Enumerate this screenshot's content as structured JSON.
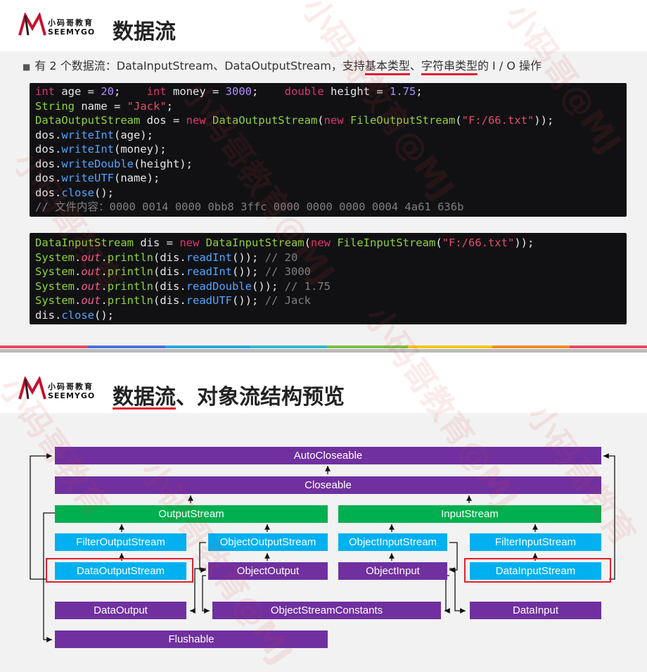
{
  "brand": {
    "cn": "小码哥教育",
    "en": "SEEMYGO"
  },
  "slide1": {
    "title": "数据流",
    "bullet": {
      "prefix": "有 2 个数据流：DataInputStream、DataOutputStream，支持",
      "u1": "基本类型",
      "mid": "、",
      "u2": "字符串类型",
      "suffix": "的 I / O 操作"
    },
    "code1": [
      "int age = 20;    int money = 3000;    double height = 1.75;",
      "String name = \"Jack\";",
      "DataOutputStream dos = new DataOutputStream(new FileOutputStream(\"F:/66.txt\"));",
      "dos.writeInt(age);",
      "dos.writeInt(money);",
      "dos.writeDouble(height);",
      "dos.writeUTF(name);",
      "dos.close();",
      "// 文件内容：0000 0014 0000 0bb8 3ffc 0000 0000 0000 0004 4a61 636b"
    ],
    "code2": [
      "DataInputStream dis = new DataInputStream(new FileInputStream(\"F:/66.txt\"));",
      "System.out.println(dis.readInt()); // 20",
      "System.out.println(dis.readInt()); // 3000",
      "System.out.println(dis.readDouble()); // 1.75",
      "System.out.println(dis.readUTF()); // Jack",
      "dis.close();"
    ]
  },
  "slide2": {
    "title_a": "数据流",
    "title_b": "、对象流结构预览",
    "nodes": {
      "autocloseable": "AutoCloseable",
      "closeable": "Closeable",
      "outputstream": "OutputStream",
      "inputstream": "InputStream",
      "filteroutputstream": "FilterOutputStream",
      "objectoutputstream": "ObjectOutputStream",
      "objectinputstream": "ObjectInputStream",
      "filterinputstream": "FilterInputStream",
      "dataoutputstream": "DataOutputStream",
      "objectoutput": "ObjectOutput",
      "objectinput": "ObjectInput",
      "datainputstream": "DataInputStream",
      "dataoutput": "DataOutput",
      "objectstreamconstants": "ObjectStreamConstants",
      "datainput": "DataInput",
      "flushable": "Flushable"
    },
    "colors": {
      "interface": "#7030a0",
      "abstract": "#00b050",
      "class": "#00b0f0",
      "highlight": "#e02030"
    }
  }
}
